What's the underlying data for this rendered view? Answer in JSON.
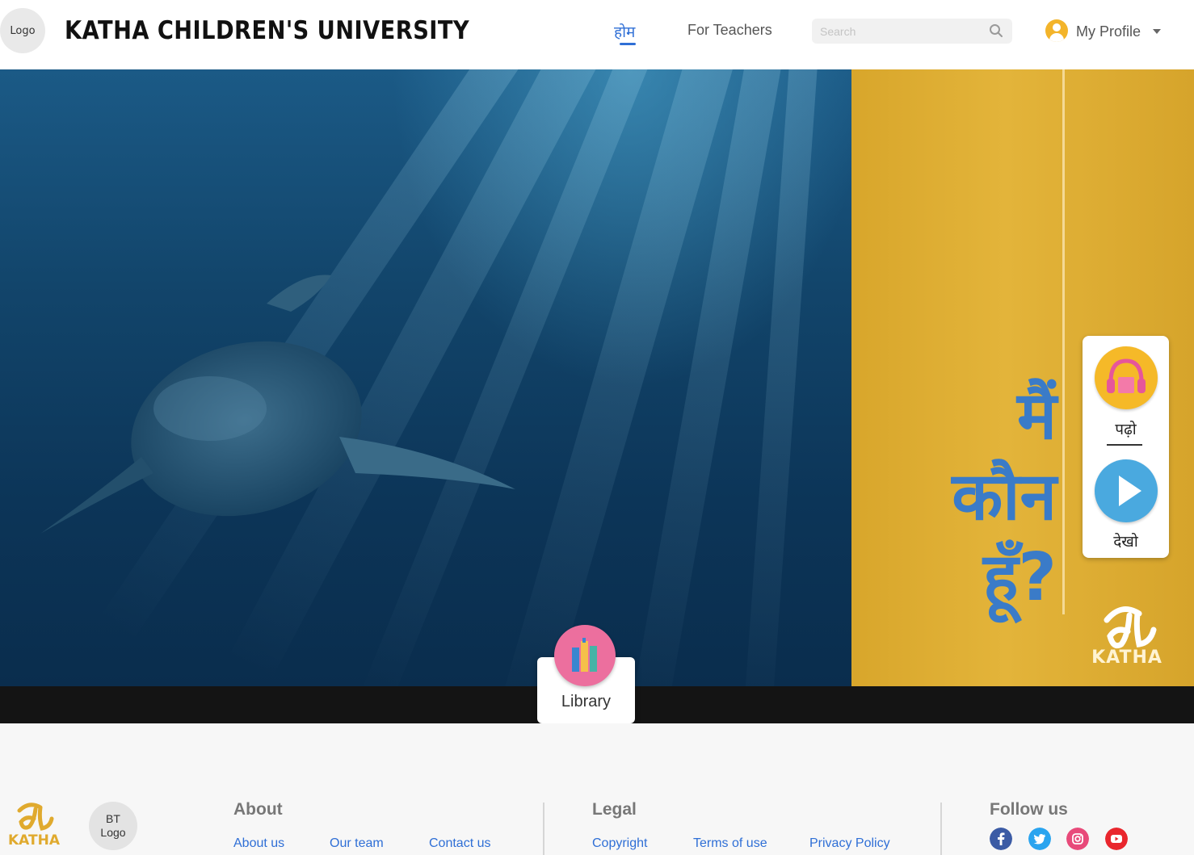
{
  "header": {
    "logo_text": "Logo",
    "site_title": "KATHA CHILDREN'S UNIVERSITY",
    "nav": {
      "home": "होम",
      "teachers": "For Teachers"
    },
    "search": {
      "placeholder": "Search",
      "icon": "search-icon"
    },
    "profile": {
      "label": "My Profile",
      "icon": "user-icon"
    }
  },
  "hero": {
    "title": "मैं\nकौन\nहूँ?",
    "side_panel": {
      "read_label": "पढ़ो",
      "watch_label": "देखो"
    },
    "brand_word": "KATHA",
    "library_label": "Library"
  },
  "footer": {
    "brand_word": "KATHA",
    "bt_logo": "BT\nLogo",
    "about": {
      "heading": "About",
      "links": [
        "About us",
        "Our team",
        "Contact us"
      ]
    },
    "legal": {
      "heading": "Legal",
      "links": [
        "Copyright",
        "Terms of use",
        "Privacy Policy"
      ]
    },
    "follow": {
      "heading": "Follow us",
      "icons": [
        "facebook-icon",
        "twitter-icon",
        "instagram-icon",
        "youtube-icon"
      ]
    }
  },
  "colors": {
    "accent": "#2f6fd6",
    "gold": "#e3b43a",
    "ocean": "#12456b",
    "library_pink": "#ec6f9e",
    "profile_yellow": "#f3b42a"
  }
}
